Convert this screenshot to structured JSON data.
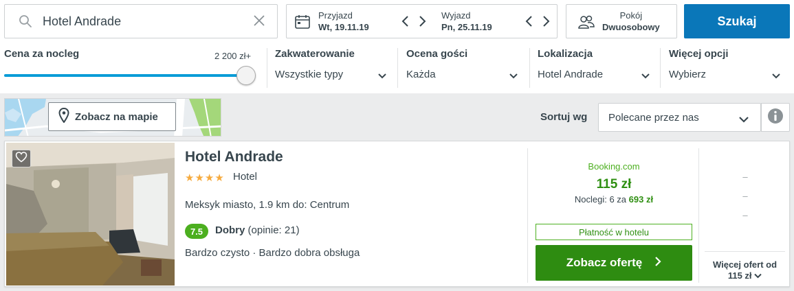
{
  "search": {
    "value": "Hotel Andrade"
  },
  "checkin": {
    "label": "Przyjazd",
    "date": "Wt, 19.11.19"
  },
  "checkout": {
    "label": "Wyjazd",
    "date": "Pn, 25.11.19"
  },
  "room": {
    "label": "Pokój",
    "value": "Dwuosobowy"
  },
  "search_button": "Szukaj",
  "filters": {
    "price": {
      "label": "Cena za nocleg",
      "max": "2 200 zł+",
      "level_percent": 100
    },
    "accommodation": {
      "label": "Zakwaterowanie",
      "value": "Wszystkie typy"
    },
    "rating": {
      "label": "Ocena gości",
      "value": "Każda"
    },
    "location": {
      "label": "Lokalizacja",
      "value": "Hotel Andrade"
    },
    "more": {
      "label": "Więcej opcji",
      "value": "Wybierz"
    }
  },
  "map_button": "Zobacz na mapie",
  "sort": {
    "label": "Sortuj wg",
    "value": "Polecane przez nas"
  },
  "result": {
    "name": "Hotel Andrade",
    "stars": 4,
    "type": "Hotel",
    "location": "Meksyk miasto, 1.9 km do: Centrum",
    "rating_score": "7.5",
    "rating_word": "Dobry",
    "rating_reviews": "(opinie: 21)",
    "features": "Bardzo czysto · Bardzo dobra obsługa",
    "provider": "Booking.com",
    "price": "115 zł",
    "nights_text": "Noclegi: 6 za",
    "nights_total": "693 zł",
    "payment_badge": "Płatność w hotelu",
    "deal_button": "Zobacz ofertę",
    "alt_prices": [
      "–",
      "–",
      "–"
    ],
    "more_offers_line1": "Więcej ofert od",
    "more_offers_line2": "115 zł"
  },
  "colors": {
    "accent_blue": "#0a77b9",
    "deal_green": "#2e8c11",
    "rating_green": "#4caf1f",
    "star_orange": "#f6ab3f"
  }
}
